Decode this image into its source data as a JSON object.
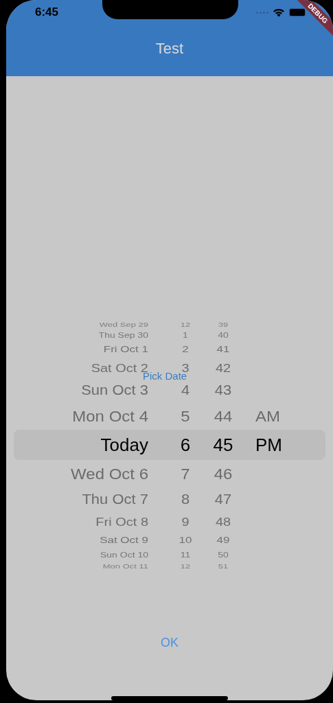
{
  "status_bar": {
    "time": "6:45"
  },
  "debug_banner": {
    "label": "DEBUG"
  },
  "app_bar": {
    "title": "Test"
  },
  "picker": {
    "rows": [
      {
        "date": "Wed Sep 29",
        "hour": "12",
        "minute": "39",
        "selected": false
      },
      {
        "date": "Thu Sep 30",
        "hour": "1",
        "minute": "40",
        "selected": false
      },
      {
        "date": "Fri Oct 1",
        "hour": "2",
        "minute": "41",
        "selected": false
      },
      {
        "date": "Sat Oct 2",
        "hour": "3",
        "minute": "42",
        "selected": false
      },
      {
        "date": "Sun Oct 3",
        "hour": "4",
        "minute": "43",
        "selected": false
      },
      {
        "date": "Mon Oct 4",
        "hour": "5",
        "minute": "44",
        "meridiem": "AM",
        "selected": false
      },
      {
        "date": "Today",
        "hour": "6",
        "minute": "45",
        "meridiem": "PM",
        "selected": true
      },
      {
        "date": "Wed Oct 6",
        "hour": "7",
        "minute": "46",
        "selected": false
      },
      {
        "date": "Thu Oct 7",
        "hour": "8",
        "minute": "47",
        "selected": false
      },
      {
        "date": "Fri Oct 8",
        "hour": "9",
        "minute": "48",
        "selected": false
      },
      {
        "date": "Sat Oct 9",
        "hour": "10",
        "minute": "49",
        "selected": false
      },
      {
        "date": "Sun Oct 10",
        "hour": "11",
        "minute": "50",
        "selected": false
      },
      {
        "date": "Mon Oct 11",
        "hour": "12",
        "minute": "51",
        "selected": false
      }
    ],
    "pick_button": "Pick Date"
  },
  "ok_button": "OK"
}
